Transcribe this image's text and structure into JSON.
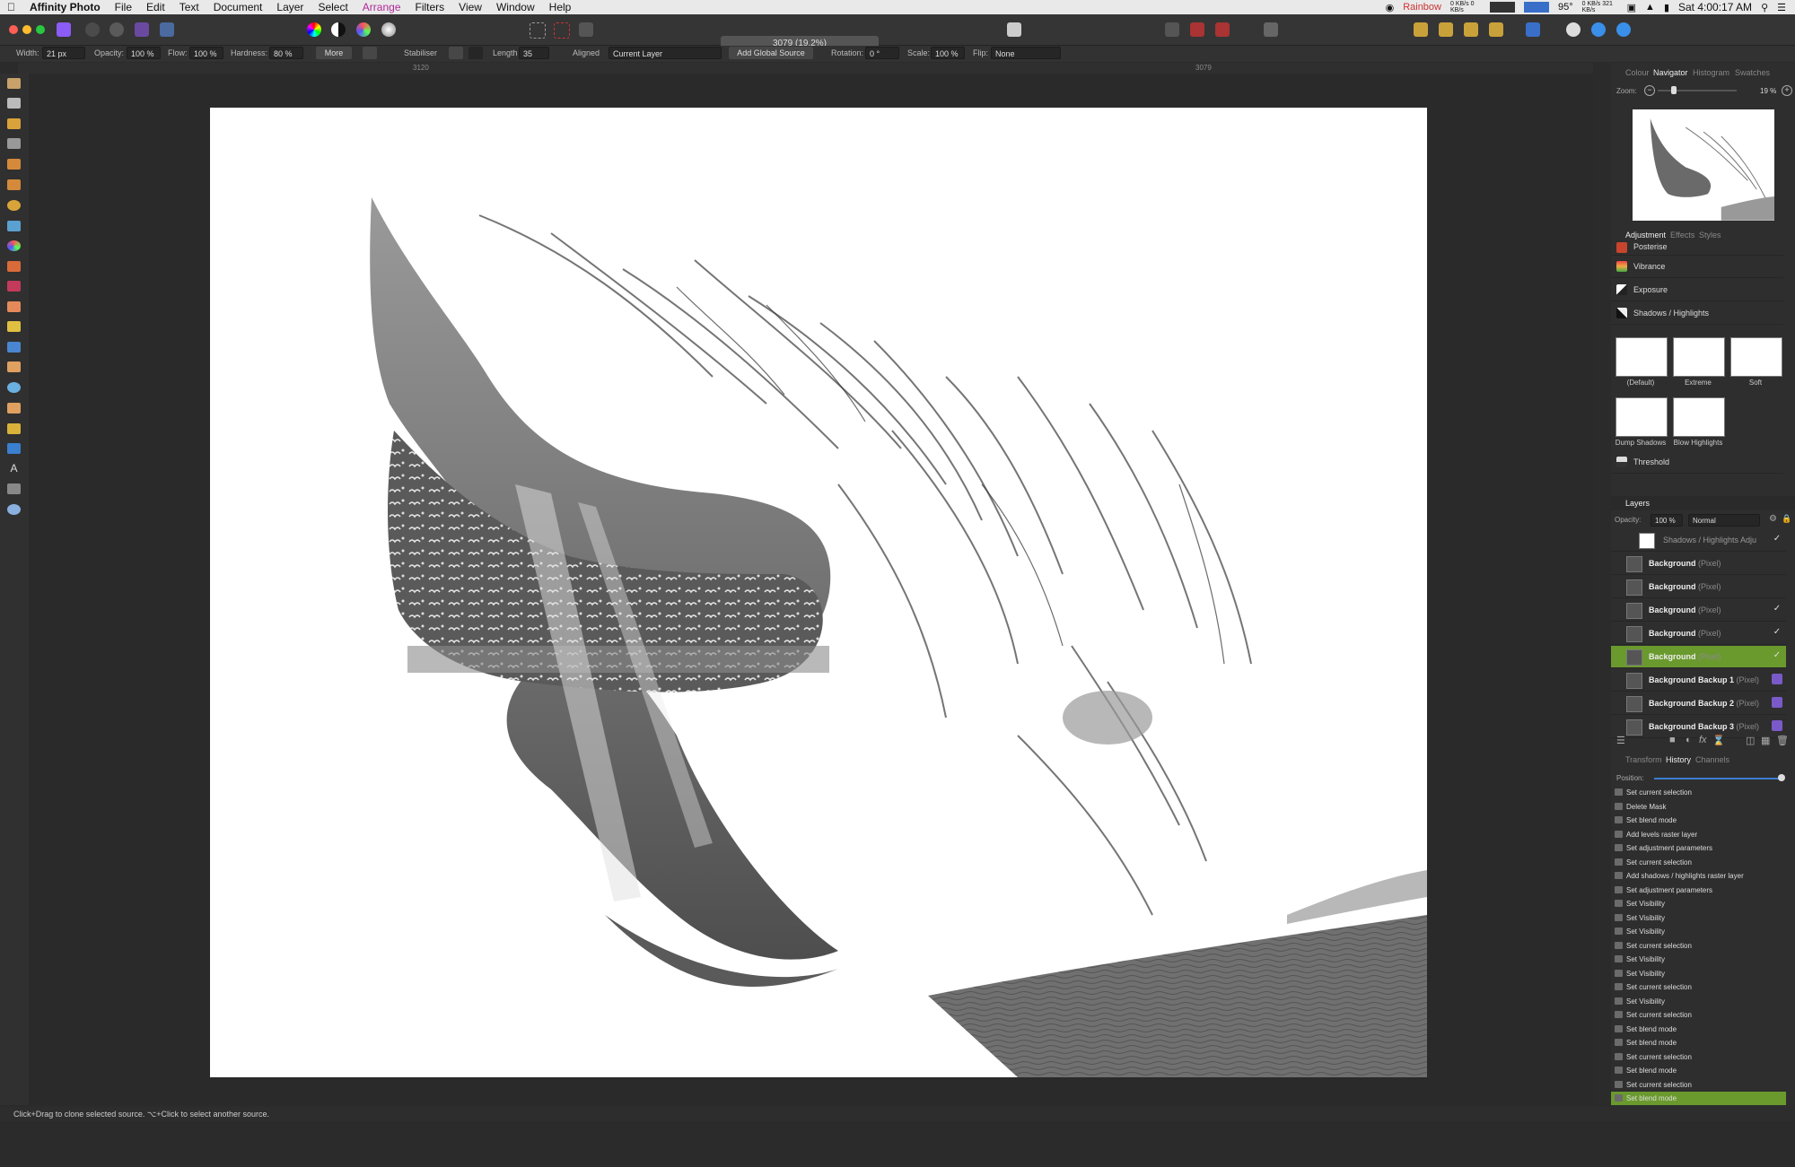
{
  "menubar": {
    "app_name": "Affinity Photo",
    "items": [
      "File",
      "Edit",
      "Text",
      "Document",
      "Layer",
      "Select",
      "Arrange",
      "Filters",
      "View",
      "Window",
      "Help"
    ],
    "active_item": "Arrange",
    "status_icons": [
      "Rainbow",
      "95°"
    ],
    "net_stats": "0 KB/s 0 KB/s",
    "net_stats2": "0 KB/s 321 KB/s",
    "clock": "Sat 4:00:17 AM"
  },
  "toolbar": {
    "document_title": "3079 (19.2%)"
  },
  "context": {
    "width_label": "Width:",
    "width_value": "21 px",
    "opacity_label": "Opacity:",
    "opacity_value": "100 %",
    "flow_label": "Flow:",
    "flow_value": "100 %",
    "hardness_label": "Hardness:",
    "hardness_value": "80 %",
    "more_label": "More",
    "stabiliser_label": "Stabiliser",
    "length_label": "Length",
    "length_value": "35",
    "aligned_label": "Aligned",
    "source_value": "Current Layer",
    "add_source_label": "Add Global Source",
    "rotation_label": "Rotation:",
    "rotation_value": "0 °",
    "scale_label": "Scale:",
    "scale_value": "100 %",
    "flip_label": "Flip:",
    "flip_value": "None"
  },
  "ruler": {
    "left_mark": "3120",
    "center_mark": "3079"
  },
  "panels": {
    "top_tabs": [
      "Colour",
      "Navigator",
      "Histogram",
      "Swatches"
    ],
    "top_active": "Navigator",
    "zoom_label": "Zoom:",
    "zoom_value": "19 %",
    "zoom_fraction": 0.2,
    "adj_tabs": [
      "Adjustment",
      "Effects",
      "Styles"
    ],
    "adj_active": "Adjustment",
    "adjustments": [
      "Posterise",
      "Vibrance",
      "Exposure",
      "Shadows / Highlights"
    ],
    "presets": [
      "(Default)",
      "Extreme",
      "Soft",
      "Dump Shadows",
      "Blow Highlights"
    ],
    "threshold_label": "Threshold",
    "layers_title": "Layers",
    "layers_opacity_label": "Opacity:",
    "layers_opacity_value": "100 %",
    "blend_mode": "Normal",
    "layers": [
      {
        "name": "Shadows / Highlights Adju",
        "kind": "",
        "check": "✓",
        "selected": false,
        "dim": true
      },
      {
        "name": "Background",
        "kind": "(Pixel)",
        "check": "",
        "selected": false
      },
      {
        "name": "Background",
        "kind": "(Pixel)",
        "check": "",
        "selected": false
      },
      {
        "name": "Background",
        "kind": "(Pixel)",
        "check": "✓",
        "selected": false
      },
      {
        "name": "Background",
        "kind": "(Pixel)",
        "check": "✓",
        "selected": false
      },
      {
        "name": "Background",
        "kind": "(Pixel)",
        "check": "✓",
        "selected": true
      },
      {
        "name": "Background Backup 1",
        "kind": "(Pixel)",
        "check": "",
        "selected": false,
        "purple": true
      },
      {
        "name": "Background Backup 2",
        "kind": "(Pixel)",
        "check": "",
        "selected": false,
        "purple": true
      },
      {
        "name": "Background Backup 3",
        "kind": "(Pixel)",
        "check": "",
        "selected": false,
        "purple": true
      }
    ],
    "bottom_tabs": [
      "Transform",
      "History",
      "Channels"
    ],
    "bottom_active": "History",
    "position_label": "Position:",
    "history": [
      "Set current selection",
      "Delete Mask",
      "Set blend mode",
      "Add levels raster layer",
      "Set adjustment parameters",
      "Set current selection",
      "Add shadows / highlights raster layer",
      "Set adjustment parameters",
      "Set Visibility",
      "Set Visibility",
      "Set Visibility",
      "Set current selection",
      "Set Visibility",
      "Set Visibility",
      "Set current selection",
      "Set Visibility",
      "Set current selection",
      "Set blend mode",
      "Set blend mode",
      "Set current selection",
      "Set blend mode",
      "Set current selection",
      "Set blend mode"
    ]
  },
  "statusbar": {
    "hint": "Click+Drag to clone selected source. ⌥+Click to select another source."
  }
}
